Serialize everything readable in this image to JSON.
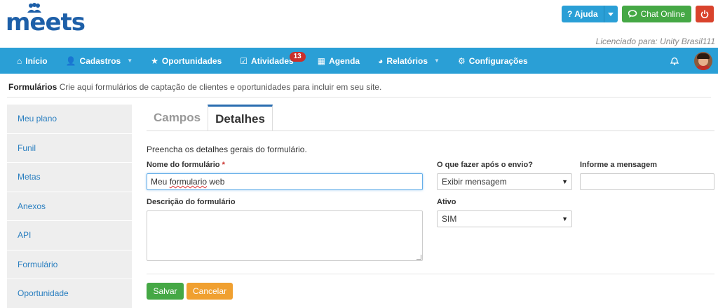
{
  "brand": {
    "logo_text": "meets",
    "color": "#1d5fa8"
  },
  "topbar": {
    "help_label": "Ajuda",
    "help_icon": "question-icon",
    "chat_label": "Chat Online",
    "chat_icon": "chat-bubbles-icon",
    "power_icon": "power-icon",
    "license": "Licenciado para: Unity Brasil111"
  },
  "nav": {
    "color": "#2a9fd6",
    "items": [
      {
        "label": "Início",
        "icon": "home-icon",
        "glyph": "⌂"
      },
      {
        "label": "Cadastros",
        "icon": "add-user-icon",
        "glyph": "👤",
        "dropdown": true
      },
      {
        "label": "Oportunidades",
        "icon": "star-icon",
        "glyph": "★"
      },
      {
        "label": "Atividades",
        "icon": "checkbox-icon",
        "glyph": "☑",
        "badge": "13"
      },
      {
        "label": "Agenda",
        "icon": "calendar-icon",
        "glyph": "▦"
      },
      {
        "label": "Relatórios",
        "icon": "pie-chart-icon",
        "glyph": "◕",
        "dropdown": true
      },
      {
        "label": "Configurações",
        "icon": "gear-icon",
        "glyph": "⚙"
      }
    ]
  },
  "breadcrumb": {
    "title": "Formulários",
    "description": "Crie aqui formulários de captação de clientes e oportunidades para incluir em seu site."
  },
  "sidebar": {
    "items": [
      "Meu plano",
      "Funil",
      "Metas",
      "Anexos",
      "API",
      "Formulário",
      "Oportunidade"
    ]
  },
  "tabs": {
    "items": [
      "Campos",
      "Detalhes"
    ],
    "active": "Detalhes"
  },
  "form": {
    "intro": "Preencha os detalhes gerais do formulário.",
    "name_label": "Nome do formulário",
    "name_required": "*",
    "name_value_a": "Meu ",
    "name_value_b": "formulario",
    "name_value_c": " web",
    "description_label": "Descrição do formulário",
    "after_label": "O que fazer após o envio?",
    "after_value": "Exibir mensagem",
    "message_label": "Informe a mensagem",
    "message_value": "",
    "active_label": "Ativo",
    "active_value": "SIM"
  },
  "actions": {
    "save": "Salvar",
    "cancel": "Cancelar",
    "save_color": "#45a845",
    "cancel_color": "#f0a030"
  }
}
